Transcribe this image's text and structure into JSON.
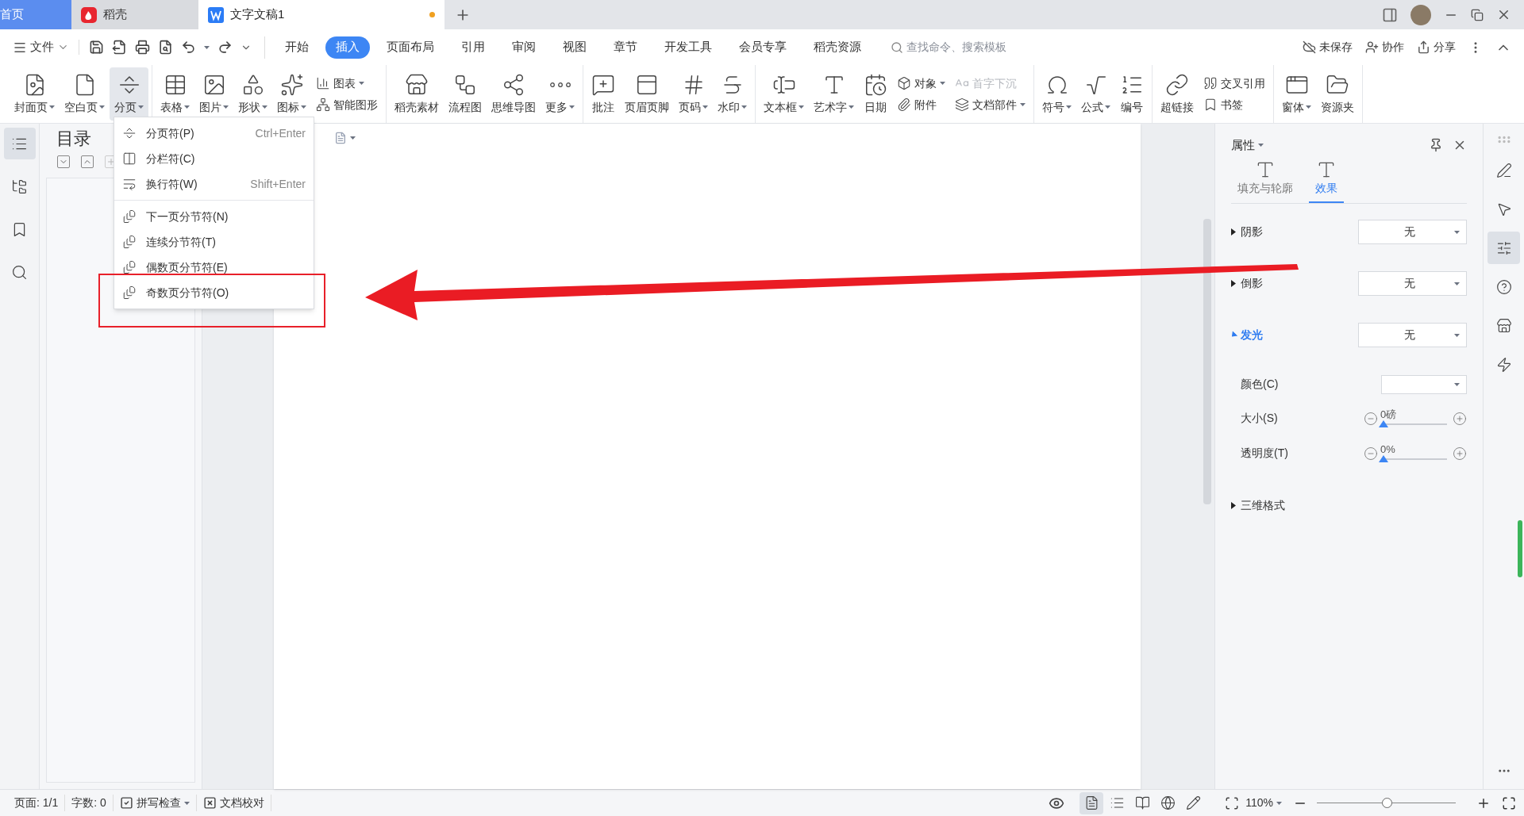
{
  "window_tabs": [
    {
      "label": "首页",
      "kind": "home",
      "selected": false,
      "modified": false
    },
    {
      "label": "稻壳",
      "kind": "app",
      "selected": false,
      "modified": false
    },
    {
      "label": "文字文稿1",
      "kind": "doc",
      "selected": true,
      "modified": true
    }
  ],
  "menu": {
    "file_label": "文件",
    "tabs": [
      {
        "label": "开始",
        "selected": false
      },
      {
        "label": "插入",
        "selected": true
      },
      {
        "label": "页面布局",
        "selected": false
      },
      {
        "label": "引用",
        "selected": false
      },
      {
        "label": "审阅",
        "selected": false
      },
      {
        "label": "视图",
        "selected": false
      },
      {
        "label": "章节",
        "selected": false
      },
      {
        "label": "开发工具",
        "selected": false
      },
      {
        "label": "会员专享",
        "selected": false
      },
      {
        "label": "稻壳资源",
        "selected": false
      }
    ],
    "search": {
      "placeholder": "查找命令、搜索模板"
    },
    "actions": [
      "未保存",
      "协作",
      "分享"
    ]
  },
  "ribbon": [
    {
      "items": [
        {
          "kind": "large",
          "label": "封面页",
          "dropdown": true,
          "selected": false
        },
        {
          "kind": "large",
          "label": "空白页",
          "dropdown": true,
          "selected": false
        },
        {
          "kind": "large",
          "label": "分页",
          "dropdown": true,
          "selected": true
        }
      ]
    },
    {
      "items": [
        {
          "kind": "large",
          "label": "表格",
          "dropdown": true,
          "selected": false
        },
        {
          "kind": "large",
          "label": "图片",
          "dropdown": true,
          "selected": false
        },
        {
          "kind": "large",
          "label": "形状",
          "dropdown": true,
          "selected": false
        },
        {
          "kind": "large",
          "label": "图标",
          "dropdown": true,
          "selected": false
        },
        {
          "kind": "stack",
          "items": [
            {
              "label": "图表",
              "dropdown": true,
              "disabled": false
            },
            {
              "label": "智能图形",
              "dropdown": false,
              "disabled": false
            }
          ]
        }
      ]
    },
    {
      "items": [
        {
          "kind": "large",
          "label": "稻壳素材",
          "dropdown": false,
          "selected": false
        },
        {
          "kind": "large",
          "label": "流程图",
          "dropdown": false,
          "selected": false
        },
        {
          "kind": "large",
          "label": "思维导图",
          "dropdown": false,
          "selected": false
        },
        {
          "kind": "large",
          "label": "更多",
          "dropdown": true,
          "selected": false
        }
      ]
    },
    {
      "items": [
        {
          "kind": "large",
          "label": "批注",
          "dropdown": false,
          "selected": false
        },
        {
          "kind": "large",
          "label": "页眉页脚",
          "dropdown": false,
          "selected": false
        },
        {
          "kind": "large",
          "label": "页码",
          "dropdown": true,
          "selected": false
        },
        {
          "kind": "large",
          "label": "水印",
          "dropdown": true,
          "selected": false
        }
      ]
    },
    {
      "items": [
        {
          "kind": "large",
          "label": "文本框",
          "dropdown": true,
          "selected": false
        },
        {
          "kind": "large",
          "label": "艺术字",
          "dropdown": true,
          "selected": false
        },
        {
          "kind": "large",
          "label": "日期",
          "dropdown": false,
          "selected": false
        },
        {
          "kind": "stack",
          "items": [
            {
              "label": "对象",
              "dropdown": true,
              "disabled": false
            },
            {
              "label": "附件",
              "dropdown": false,
              "disabled": false
            }
          ]
        },
        {
          "kind": "stack",
          "items": [
            {
              "label": "首字下沉",
              "dropdown": false,
              "disabled": true
            },
            {
              "label": "文档部件",
              "dropdown": true,
              "disabled": false
            }
          ]
        }
      ]
    },
    {
      "items": [
        {
          "kind": "large",
          "label": "符号",
          "dropdown": true,
          "selected": false
        },
        {
          "kind": "large",
          "label": "公式",
          "dropdown": true,
          "selected": false
        },
        {
          "kind": "large",
          "label": "编号",
          "dropdown": false,
          "selected": false
        }
      ]
    },
    {
      "items": [
        {
          "kind": "large",
          "label": "超链接",
          "dropdown": false,
          "selected": false
        },
        {
          "kind": "stack",
          "items": [
            {
              "label": "交叉引用",
              "dropdown": false,
              "disabled": false
            },
            {
              "label": "书签",
              "dropdown": false,
              "disabled": false
            }
          ]
        }
      ]
    },
    {
      "items": [
        {
          "kind": "large",
          "label": "窗体",
          "dropdown": true,
          "selected": false
        },
        {
          "kind": "large",
          "label": "资源夹",
          "dropdown": false,
          "selected": false
        }
      ]
    }
  ],
  "dropdown_menu": [
    [
      {
        "label": "分页符(P)",
        "shortcut": "Ctrl+Enter"
      },
      {
        "label": "分栏符(C)"
      },
      {
        "label": "换行符(W)",
        "shortcut": "Shift+Enter"
      }
    ],
    [
      {
        "label": "下一页分节符(N)"
      },
      {
        "label": "连续分节符(T)"
      },
      {
        "label": "偶数页分节符(E)"
      },
      {
        "label": "奇数页分节符(O)"
      }
    ]
  ],
  "left_sidebar": [
    {
      "selected": true
    },
    {
      "selected": false
    },
    {
      "selected": false
    },
    {
      "selected": false
    }
  ],
  "outline": {
    "title": "目录",
    "buttons": [
      {
        "disabled": false
      },
      {
        "disabled": false
      },
      {
        "disabled": true
      }
    ]
  },
  "properties": {
    "title": "属性",
    "tabs": [
      {
        "label": "填充与轮廓",
        "selected": false
      },
      {
        "label": "效果",
        "selected": true
      }
    ],
    "sections": [
      {
        "kind": "section",
        "label": "阴影",
        "expanded": false,
        "value": "无"
      },
      {
        "kind": "section",
        "label": "倒影",
        "expanded": false,
        "value": "无"
      },
      {
        "kind": "section",
        "label": "发光",
        "expanded": true,
        "value": "无"
      },
      {
        "kind": "color",
        "label": "颜色(C)"
      },
      {
        "kind": "slider",
        "label": "大小(S)",
        "reading": "0磅",
        "level": 0
      },
      {
        "kind": "slider",
        "label": "透明度(T)",
        "reading": "0%",
        "level": 0
      },
      {
        "kind": "heading",
        "label": "三维格式",
        "expanded": false
      }
    ]
  },
  "right_strip": [
    {
      "selected": false
    },
    {
      "selected": false
    },
    {
      "selected": true
    },
    {
      "selected": false
    },
    {
      "selected": false
    },
    {
      "selected": false
    }
  ],
  "status_bar": {
    "items": [
      "页面: 1/1",
      "字数: 0"
    ],
    "spell": "拼写检查",
    "proof": "文档校对",
    "views": [
      {
        "selected": true
      },
      {
        "selected": false
      },
      {
        "selected": false
      },
      {
        "selected": false
      },
      {
        "selected": false
      }
    ],
    "zoom": "110%",
    "zoom_level": {
      "level": 0.5
    }
  }
}
